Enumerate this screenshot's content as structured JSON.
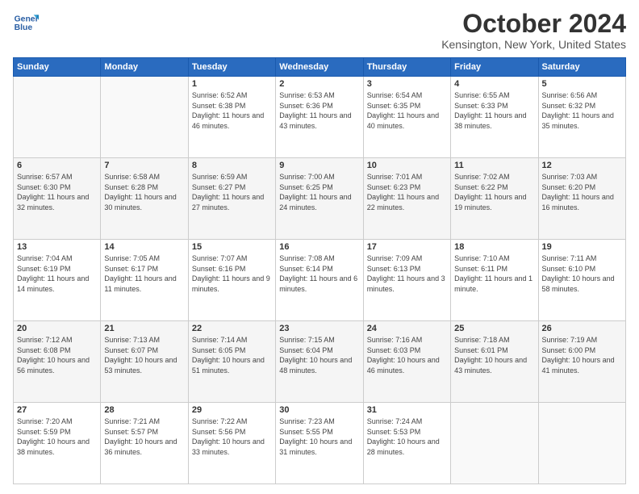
{
  "header": {
    "logo_line1": "General",
    "logo_line2": "Blue",
    "month": "October 2024",
    "location": "Kensington, New York, United States"
  },
  "weekdays": [
    "Sunday",
    "Monday",
    "Tuesday",
    "Wednesday",
    "Thursday",
    "Friday",
    "Saturday"
  ],
  "weeks": [
    [
      {
        "day": "",
        "info": ""
      },
      {
        "day": "",
        "info": ""
      },
      {
        "day": "1",
        "info": "Sunrise: 6:52 AM\nSunset: 6:38 PM\nDaylight: 11 hours and 46 minutes."
      },
      {
        "day": "2",
        "info": "Sunrise: 6:53 AM\nSunset: 6:36 PM\nDaylight: 11 hours and 43 minutes."
      },
      {
        "day": "3",
        "info": "Sunrise: 6:54 AM\nSunset: 6:35 PM\nDaylight: 11 hours and 40 minutes."
      },
      {
        "day": "4",
        "info": "Sunrise: 6:55 AM\nSunset: 6:33 PM\nDaylight: 11 hours and 38 minutes."
      },
      {
        "day": "5",
        "info": "Sunrise: 6:56 AM\nSunset: 6:32 PM\nDaylight: 11 hours and 35 minutes."
      }
    ],
    [
      {
        "day": "6",
        "info": "Sunrise: 6:57 AM\nSunset: 6:30 PM\nDaylight: 11 hours and 32 minutes."
      },
      {
        "day": "7",
        "info": "Sunrise: 6:58 AM\nSunset: 6:28 PM\nDaylight: 11 hours and 30 minutes."
      },
      {
        "day": "8",
        "info": "Sunrise: 6:59 AM\nSunset: 6:27 PM\nDaylight: 11 hours and 27 minutes."
      },
      {
        "day": "9",
        "info": "Sunrise: 7:00 AM\nSunset: 6:25 PM\nDaylight: 11 hours and 24 minutes."
      },
      {
        "day": "10",
        "info": "Sunrise: 7:01 AM\nSunset: 6:23 PM\nDaylight: 11 hours and 22 minutes."
      },
      {
        "day": "11",
        "info": "Sunrise: 7:02 AM\nSunset: 6:22 PM\nDaylight: 11 hours and 19 minutes."
      },
      {
        "day": "12",
        "info": "Sunrise: 7:03 AM\nSunset: 6:20 PM\nDaylight: 11 hours and 16 minutes."
      }
    ],
    [
      {
        "day": "13",
        "info": "Sunrise: 7:04 AM\nSunset: 6:19 PM\nDaylight: 11 hours and 14 minutes."
      },
      {
        "day": "14",
        "info": "Sunrise: 7:05 AM\nSunset: 6:17 PM\nDaylight: 11 hours and 11 minutes."
      },
      {
        "day": "15",
        "info": "Sunrise: 7:07 AM\nSunset: 6:16 PM\nDaylight: 11 hours and 9 minutes."
      },
      {
        "day": "16",
        "info": "Sunrise: 7:08 AM\nSunset: 6:14 PM\nDaylight: 11 hours and 6 minutes."
      },
      {
        "day": "17",
        "info": "Sunrise: 7:09 AM\nSunset: 6:13 PM\nDaylight: 11 hours and 3 minutes."
      },
      {
        "day": "18",
        "info": "Sunrise: 7:10 AM\nSunset: 6:11 PM\nDaylight: 11 hours and 1 minute."
      },
      {
        "day": "19",
        "info": "Sunrise: 7:11 AM\nSunset: 6:10 PM\nDaylight: 10 hours and 58 minutes."
      }
    ],
    [
      {
        "day": "20",
        "info": "Sunrise: 7:12 AM\nSunset: 6:08 PM\nDaylight: 10 hours and 56 minutes."
      },
      {
        "day": "21",
        "info": "Sunrise: 7:13 AM\nSunset: 6:07 PM\nDaylight: 10 hours and 53 minutes."
      },
      {
        "day": "22",
        "info": "Sunrise: 7:14 AM\nSunset: 6:05 PM\nDaylight: 10 hours and 51 minutes."
      },
      {
        "day": "23",
        "info": "Sunrise: 7:15 AM\nSunset: 6:04 PM\nDaylight: 10 hours and 48 minutes."
      },
      {
        "day": "24",
        "info": "Sunrise: 7:16 AM\nSunset: 6:03 PM\nDaylight: 10 hours and 46 minutes."
      },
      {
        "day": "25",
        "info": "Sunrise: 7:18 AM\nSunset: 6:01 PM\nDaylight: 10 hours and 43 minutes."
      },
      {
        "day": "26",
        "info": "Sunrise: 7:19 AM\nSunset: 6:00 PM\nDaylight: 10 hours and 41 minutes."
      }
    ],
    [
      {
        "day": "27",
        "info": "Sunrise: 7:20 AM\nSunset: 5:59 PM\nDaylight: 10 hours and 38 minutes."
      },
      {
        "day": "28",
        "info": "Sunrise: 7:21 AM\nSunset: 5:57 PM\nDaylight: 10 hours and 36 minutes."
      },
      {
        "day": "29",
        "info": "Sunrise: 7:22 AM\nSunset: 5:56 PM\nDaylight: 10 hours and 33 minutes."
      },
      {
        "day": "30",
        "info": "Sunrise: 7:23 AM\nSunset: 5:55 PM\nDaylight: 10 hours and 31 minutes."
      },
      {
        "day": "31",
        "info": "Sunrise: 7:24 AM\nSunset: 5:53 PM\nDaylight: 10 hours and 28 minutes."
      },
      {
        "day": "",
        "info": ""
      },
      {
        "day": "",
        "info": ""
      }
    ]
  ]
}
